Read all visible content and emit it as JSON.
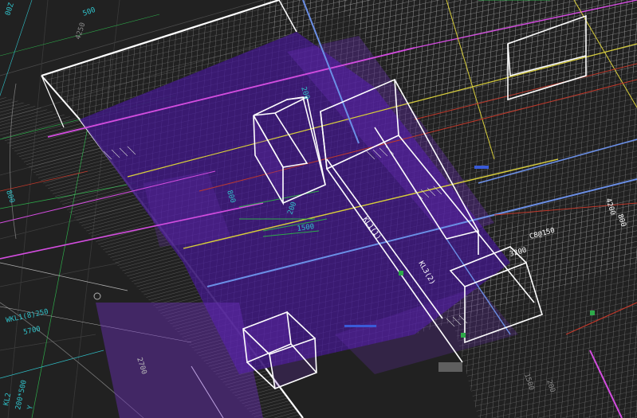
{
  "colors": {
    "background": "#212121",
    "slab_fill": "#3d1a78",
    "slab_overlay": "#6b2fb8",
    "wire_white": "#ffffff",
    "grid_gray": "#8a8a8a",
    "magenta": "#d44de0",
    "yellow": "#d9cf3b",
    "red": "#c0392b",
    "blue": "#6b8fe6",
    "green": "#2eaa4a",
    "cyan": "#30c0c8"
  },
  "labels": {
    "top_left_code": "00Z",
    "top_left_mark": "4250",
    "dim_200_a": "200",
    "dim_200_b": "200",
    "dim_800": "800",
    "dim_1500": "1500",
    "left_dim_500": "500",
    "left_dim_800": "800",
    "beam_left_code": "WKL1(8)250",
    "beam_left_span": "5700",
    "bottom_left_code_1": "KL2",
    "bottom_left_code_2": "200*500",
    "bottom_left_code_3": "Y",
    "mid_purple_dim": "2700",
    "right_dim_1": "4200",
    "right_dim_2": "800",
    "right_dim_3": "3200",
    "beam_tag_1": "KL1(1)",
    "beam_tag_2": "KL3(2)",
    "rebar_tag": "C8@150",
    "bottom_right_dim": "1500",
    "bottom_right_dim_2": "200"
  }
}
